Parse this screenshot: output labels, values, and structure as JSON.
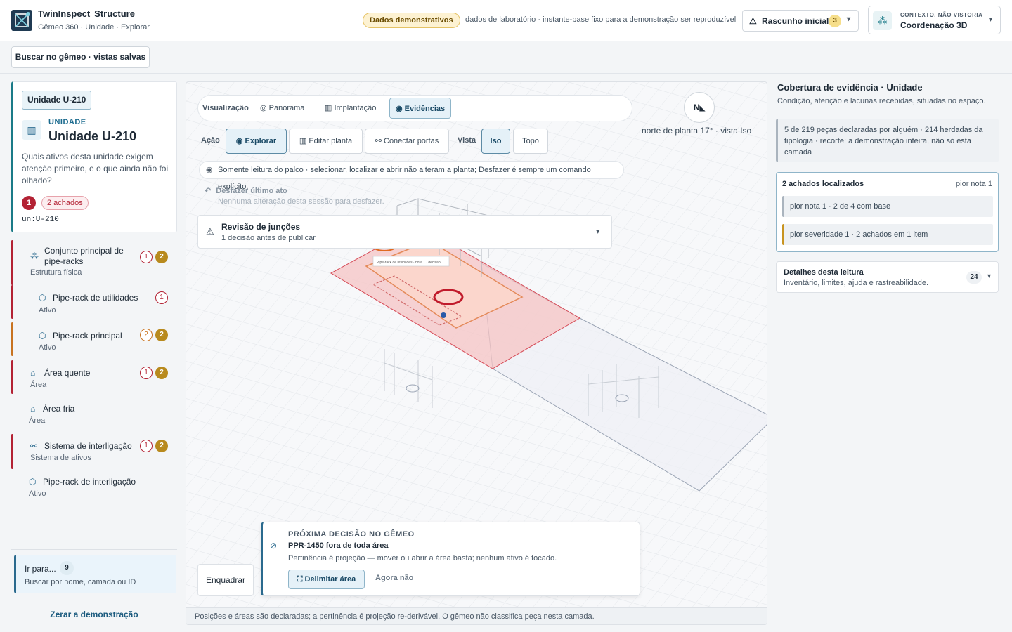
{
  "header": {
    "brand_name": "TwinInspect",
    "brand_product": "Structure",
    "breadcrumb": "Gêmeo 360 · Unidade · Explorar",
    "demo_badge": "Dados demonstrativos",
    "demo_text": "dados de laboratório · instante-base fixo para a demonstração ser reproduzível",
    "draft_label": "Rascunho inicial",
    "draft_count": "3",
    "context_kicker": "CONTEXTO, NÃO VISTORIA",
    "context_value": "Coordenação 3D"
  },
  "search_button": "Buscar no gêmeo · vistas salvas",
  "unit": {
    "tag": "Unidade U-210",
    "kind": "UNIDADE",
    "title": "Unidade U-210",
    "question": "Quais ativos desta unidade exigem atenção primeiro, e o que ainda não foi olhado?",
    "severity": "1",
    "findings": "2 achados",
    "id": "un:U-210"
  },
  "tree": [
    {
      "name": "Conjunto principal de pipe-racks",
      "sub": "Estrutura física",
      "ring": "1",
      "count": "2",
      "icon": "cluster-icon"
    },
    {
      "name": "Pipe-rack de utilidades",
      "sub": "Ativo",
      "ring": "1",
      "count": "",
      "icon": "cube-icon"
    },
    {
      "name": "Pipe-rack principal",
      "sub": "Ativo",
      "ring": "2",
      "count": "2",
      "icon": "cube-icon"
    },
    {
      "name": "Área quente",
      "sub": "Área",
      "ring": "1",
      "count": "2",
      "icon": "building-icon"
    },
    {
      "name": "Área fria",
      "sub": "Área",
      "ring": "",
      "count": "",
      "icon": "building-icon"
    },
    {
      "name": "Sistema de interligação",
      "sub": "Sistema de ativos",
      "ring": "1",
      "count": "2",
      "icon": "network-icon"
    },
    {
      "name": "Pipe-rack de interligação",
      "sub": "Ativo",
      "ring": "",
      "count": "",
      "icon": "cube-icon"
    }
  ],
  "goto": {
    "label": "Ir para...",
    "count": "9",
    "hint": "Buscar por nome, camada ou ID"
  },
  "reset": "Zerar a demonstração",
  "stage": {
    "viz_label": "Visualização",
    "viz_tabs": [
      "Panorama",
      "Implantação",
      "Evidências"
    ],
    "action_label": "Ação",
    "actions": [
      "Explorar",
      "Editar planta",
      "Conectar portas"
    ],
    "view_label": "Vista",
    "views": [
      "Iso",
      "Topo"
    ],
    "readonly": "Somente leitura do palco · selecionar, localizar e abrir não alteram a planta; Desfazer é sempre um comando explícito.",
    "undo_title": "Desfazer último ato",
    "undo_sub": "Nenhuma alteração desta sessão para desfazer.",
    "review_title": "Revisão de junções",
    "review_sub": "1 decisão antes de publicar",
    "compass": "N",
    "north": "norte de planta 17° · vista Iso",
    "scene_label": "Pipe-rack de utilidades · nota 1 · decisão",
    "next_kicker": "PRÓXIMA DECISÃO NO GÊMEO",
    "next_title": "PPR-1450 fora de toda área",
    "next_sub": "Pertinência é projeção — mover ou abrir a área basta; nenhum ativo é tocado.",
    "next_primary": "Delimitar área",
    "next_secondary": "Agora não",
    "frame": "Enquadrar",
    "footer": "Posições e áreas são declaradas; a pertinência é projeção re-derivável. O gêmeo não classifica peça nesta camada."
  },
  "coverage": {
    "title": "Cobertura de evidência · Unidade",
    "subtitle": "Condição, atenção e lacunas recebidas, situadas no espaço.",
    "note": "5 de 219 peças declaradas por alguém · 214 herdadas da tipologia · recorte: a demonstração inteira, não só esta camada",
    "findings_title": "2 achados localizados",
    "findings_right": "pior nota 1",
    "rows": [
      "pior nota 1 · 2 de 4 com base",
      "pior severidade 1 · 2 achados em 1 item"
    ],
    "details_title": "Detalhes desta leitura",
    "details_sub": "Inventário, limites, ajuda e rastreabilidade.",
    "details_count": "24"
  }
}
